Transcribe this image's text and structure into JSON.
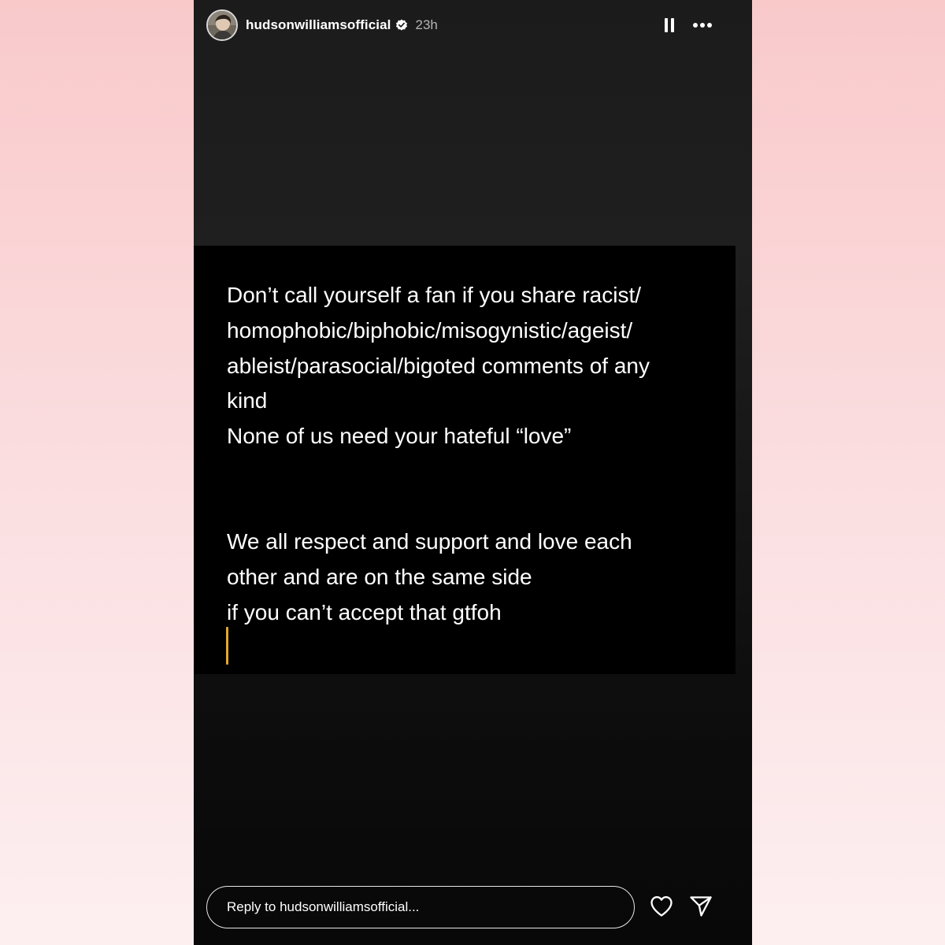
{
  "header": {
    "username": "hudsonwilliamsofficial",
    "timestamp": "23h",
    "verified_icon": "verified-badge-icon",
    "pause_icon": "pause-icon",
    "more_icon": "more-options-icon"
  },
  "story_text": {
    "block1_lines": [
      "Don’t call yourself a fan if you share racist/",
      "homophobic/biphobic/misogynistic/ageist/",
      "ableist/parasocial/bigoted comments of any",
      "kind",
      "None of us need your hateful “love”"
    ],
    "block2_lines": [
      "We all respect and support and love each",
      "other and are on the same side",
      "if you can’t accept that gtfoh"
    ]
  },
  "footer": {
    "reply_placeholder": "Reply to hudsonwilliamsofficial...",
    "like_icon": "heart-icon",
    "share_icon": "send-icon"
  },
  "colors": {
    "page_background_top": "#f9c9ca",
    "page_background_bottom": "#fdeff0",
    "story_background": "#1b1b1b",
    "text_card_background": "#000000",
    "text_color": "#ffffff",
    "caret_color": "#e0a92b",
    "timestamp_color": "#b5b5b5"
  }
}
